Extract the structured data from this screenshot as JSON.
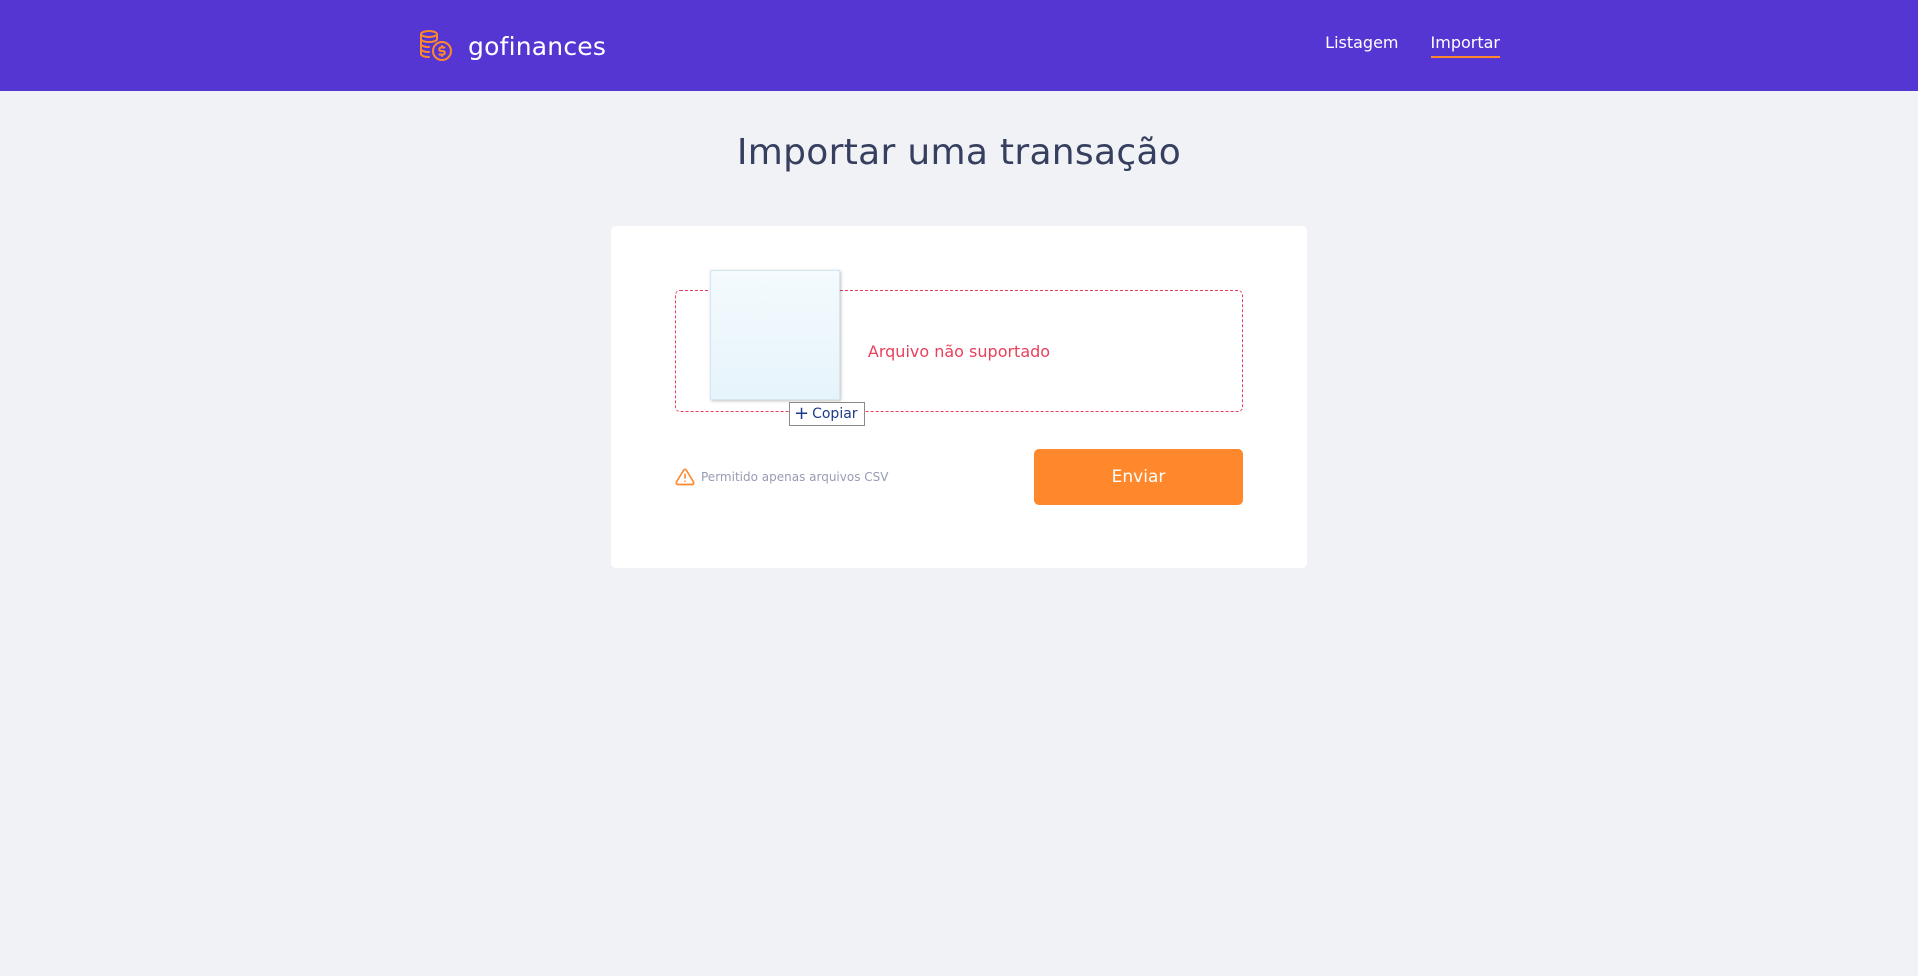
{
  "header": {
    "brand": "gofinances",
    "logo_icon": "coins-dollar-icon",
    "nav": [
      {
        "label": "Listagem",
        "active": false
      },
      {
        "label": "Importar",
        "active": true
      }
    ],
    "background_color": "#5636d3",
    "accent_color": "#ff872c"
  },
  "main": {
    "title": "Importar uma transação",
    "dropzone": {
      "message": "Arquivo não suportado",
      "state": "error",
      "error_color": "#e83f5b"
    },
    "drag_overlay": {
      "action_label": "Copiar",
      "action_icon": "plus-icon"
    },
    "hint": {
      "icon": "alert-triangle-icon",
      "text": "Permitido apenas arquivos CSV"
    },
    "submit_label": "Enviar"
  }
}
